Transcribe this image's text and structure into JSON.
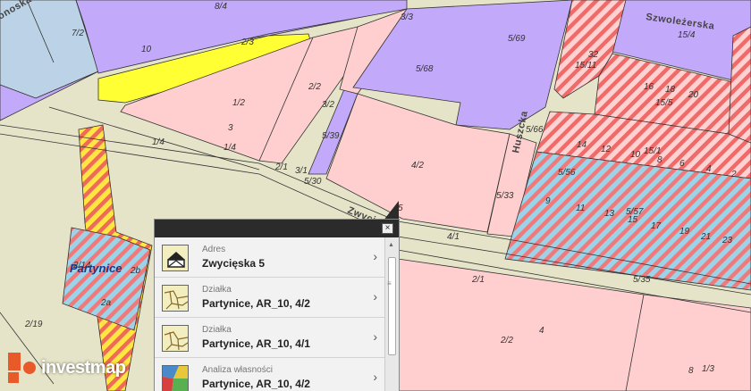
{
  "map": {
    "streets": [
      "Szwoleżerska",
      "Huszcka",
      "Zwyci",
      "onoska"
    ],
    "district": "Partynice",
    "parcels": [
      "8/4",
      "3/3",
      "7/2",
      "10",
      "2/3",
      "5/69",
      "5/68",
      "1/2",
      "2/2",
      "3/2",
      "5/39",
      "5/66",
      "4/2",
      "5/33",
      "5/56",
      "5/57",
      "1/4",
      "2/1",
      "3/1",
      "5/30",
      "4/1",
      "5/35",
      "15/4",
      "15/11",
      "15/5",
      "15/1",
      "2/19",
      "2/2",
      "1/3",
      "2/1",
      "2b",
      "2a",
      "13",
      "14",
      "12",
      "10",
      "8",
      "6",
      "4",
      "2",
      "9",
      "11",
      "15",
      "17",
      "19",
      "21",
      "23",
      "32",
      "16",
      "18",
      "20",
      "3",
      "4",
      "8",
      "2/14"
    ],
    "colors": {
      "residential": "#ffcfcf",
      "service": "#c3a9f9",
      "road": "#e6e4c8",
      "yellow": "#ffff33",
      "blue": "#bcd2e6",
      "hatch_red": "#f06060",
      "hatch_cyan": "#8ccfe8"
    }
  },
  "popup": {
    "close_icon": "×",
    "rows": [
      {
        "category": "Adres",
        "value": "Zwycięska 5",
        "icon": "envelope-icon"
      },
      {
        "category": "Działka",
        "value": "Partynice, AR_10, 4/2",
        "icon": "parcel-map-icon"
      },
      {
        "category": "Działka",
        "value": "Partynice, AR_10, 4/1",
        "icon": "parcel-map-icon"
      },
      {
        "category": "Analiza własności",
        "value": "Partynice, AR_10, 4/2",
        "icon": "ownership-map-icon"
      }
    ]
  },
  "logo": {
    "brand": "investmap"
  }
}
